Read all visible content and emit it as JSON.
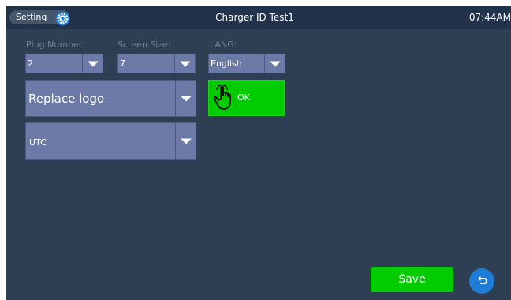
{
  "topbar": {
    "setting_label": "Setting",
    "gear_icon": "gear-icon",
    "title": "Charger ID Test1",
    "time": "07:44AM"
  },
  "fields": {
    "plug_number": {
      "label": "Plug Number:",
      "value": "2"
    },
    "screen_size": {
      "label": "Screen Size:",
      "value": "7"
    },
    "lang": {
      "label": "LANG:",
      "value": "English"
    },
    "logo": {
      "value": "Replace logo"
    },
    "timezone": {
      "value": "UTC"
    }
  },
  "buttons": {
    "ok_label": "OK",
    "ok_icon": "pointing-hand-icon",
    "save_label": "Save",
    "back_icon": "return-arrow-icon"
  },
  "colors": {
    "background": "#2e3f54",
    "topbar": "#22324a",
    "select": "#6d7aa7",
    "ok_green": "#00cc00",
    "save_green": "#00cc00",
    "back_blue": "#1e7ed7"
  }
}
